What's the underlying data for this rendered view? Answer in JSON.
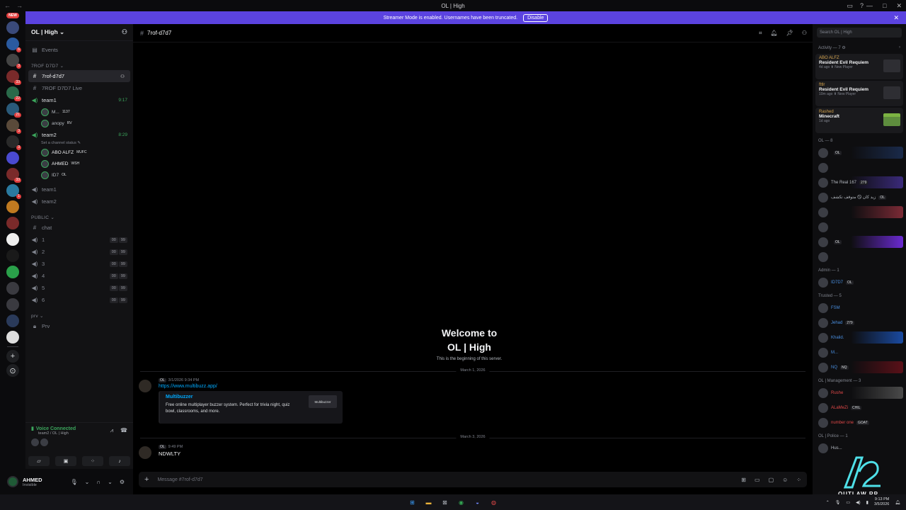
{
  "window": {
    "title": "OL | High"
  },
  "banner": {
    "text": "Streamer Mode is enabled. Usernames have been truncated.",
    "button": "Disable",
    "close": "✕"
  },
  "rail": {
    "new_badge": "NEW",
    "servers": [
      {
        "count": ""
      },
      {
        "count": "6"
      },
      {
        "count": "3"
      },
      {
        "count": "33"
      },
      {
        "count": "22"
      },
      {
        "count": "21"
      },
      {
        "count": "3"
      },
      {
        "count": "3"
      },
      {
        "count": ""
      },
      {
        "count": "33"
      },
      {
        "count": "1"
      },
      {
        "count": ""
      },
      {
        "count": ""
      },
      {
        "count": ""
      },
      {
        "count": ""
      },
      {
        "count": ""
      },
      {
        "count": ""
      },
      {
        "count": ""
      },
      {
        "count": ""
      },
      {
        "count": ""
      }
    ]
  },
  "sidebar": {
    "server_name": "OL | High ⌄",
    "events_label": "Events",
    "category1": "7ROF D7D7 ⌄",
    "active_channel": "7rof-d7d7",
    "live_channel": "7ROF D7D7 Live",
    "team1": {
      "label": "team1",
      "time": "9:17",
      "users": [
        {
          "name": "M...",
          "tag": "1137"
        },
        {
          "name": "anopy",
          "tag": "RV"
        }
      ]
    },
    "team2": {
      "label": "team2",
      "time": "8:29",
      "status": "Set a channel status ✎",
      "users": [
        {
          "name": "ABO ALFZ",
          "tag": "MUFC"
        },
        {
          "name": "AHMED",
          "tag": "WSH"
        },
        {
          "name": "ID7",
          "tag": "OL"
        }
      ]
    },
    "team1b": "team1",
    "team2b": "team2",
    "category2": "PUBLIC ⌄",
    "chat": "chat",
    "voice_channels": [
      {
        "label": "1",
        "a": "00",
        "b": "99"
      },
      {
        "label": "2",
        "a": "00",
        "b": "99"
      },
      {
        "label": "3",
        "a": "00",
        "b": "99"
      },
      {
        "label": "4",
        "a": "00",
        "b": "99"
      },
      {
        "label": "5",
        "a": "00",
        "b": "99"
      },
      {
        "label": "6",
        "a": "00",
        "b": "99"
      }
    ],
    "category3": "prv ⌄",
    "prv": "Prv"
  },
  "voice_panel": {
    "status": "Voice Connected",
    "sub": "team2 / OL | High"
  },
  "user_panel": {
    "name": "AHMED",
    "status": "Invisible"
  },
  "channel_header": {
    "name": "7rof-d7d7"
  },
  "main": {
    "welcome_title_1": "Welcome to",
    "welcome_title_2": "OL | High",
    "welcome_sub": "This is the beginning of this server.",
    "date1": "March 1, 2026",
    "date2": "March 3, 2026",
    "msg1": {
      "tag": "OL",
      "time": "3/1/2026 9:34 PM",
      "link": "https://www.multibuzz.app/"
    },
    "embed": {
      "title": "Multibuzzer",
      "desc": "Free online multiplayer buzzer system. Perfect for trivia night, quiz bowl, classrooms, and more.",
      "thumb": "Multibuzzer"
    },
    "msg2": {
      "tag": "OL",
      "time": "9:49 PM",
      "body": "NDWLTY"
    }
  },
  "composer": {
    "placeholder": "Message #7rof-d7d7"
  },
  "members": {
    "search_placeholder": "Search OL | High",
    "activity_header": "Activity — 7 ⚙",
    "activities": [
      {
        "user": "ABO ALFZ",
        "game": "Resident Evil Requiem",
        "meta": "4d ago  ⬆ New Player"
      },
      {
        "user": "fttlr",
        "game": "Resident Evil Requiem",
        "meta": "10m ago  ⬆ New Player"
      },
      {
        "user": "Rashed",
        "game": "Minecraft",
        "meta": "1d ago"
      }
    ],
    "groups": [
      {
        "header": "OL — 8",
        "rows": [
          {
            "name": "",
            "tag": "OL",
            "plate": "#1a2a4a"
          },
          {
            "name": "",
            "tag": "",
            "plate": ""
          },
          {
            "name": "The Real 167",
            "tag": "279",
            "plate": "#3a2a7a"
          },
          {
            "name": "زيد كان 🛇 متوقف تكشف",
            "tag": "OL",
            "plate": ""
          },
          {
            "name": "",
            "tag": "",
            "plate": "#7a2a35"
          },
          {
            "name": "",
            "tag": "",
            "plate": ""
          },
          {
            "name": "",
            "tag": "OL",
            "plate": "#6a2ad0"
          },
          {
            "name": "",
            "tag": "",
            "plate": ""
          }
        ]
      },
      {
        "header": "Admin — 1",
        "rows": [
          {
            "name": "ID7D7",
            "tag": "OL",
            "plate": ""
          }
        ]
      },
      {
        "header": "Trusted — 5",
        "rows": [
          {
            "name": "FSM",
            "tag": "",
            "plate": ""
          },
          {
            "name": "Jehad",
            "tag": "279",
            "plate": ""
          },
          {
            "name": "Khalid.",
            "tag": "",
            "plate": "#1a4aa0"
          },
          {
            "name": "M...",
            "tag": "",
            "plate": ""
          },
          {
            "name": "NQ",
            "tag": "NQ",
            "plate": "#5a1018"
          }
        ]
      },
      {
        "header": "OL | Management — 3",
        "rows": [
          {
            "name": "Rushe",
            "tag": "",
            "plate": "#4a4a4a"
          },
          {
            "name": "ALaMeZi",
            "tag": "CHIL",
            "plate": ""
          },
          {
            "name": "number one",
            "tag": "GOAT",
            "plate": ""
          }
        ]
      },
      {
        "header": "OL | Police — 1",
        "rows": [
          {
            "name": "Hus...",
            "tag": "",
            "plate": ""
          }
        ]
      }
    ]
  },
  "watermark": "OUTLAW RP",
  "taskbar": {
    "time": "9:13 PM",
    "date": "3/5/2026"
  }
}
